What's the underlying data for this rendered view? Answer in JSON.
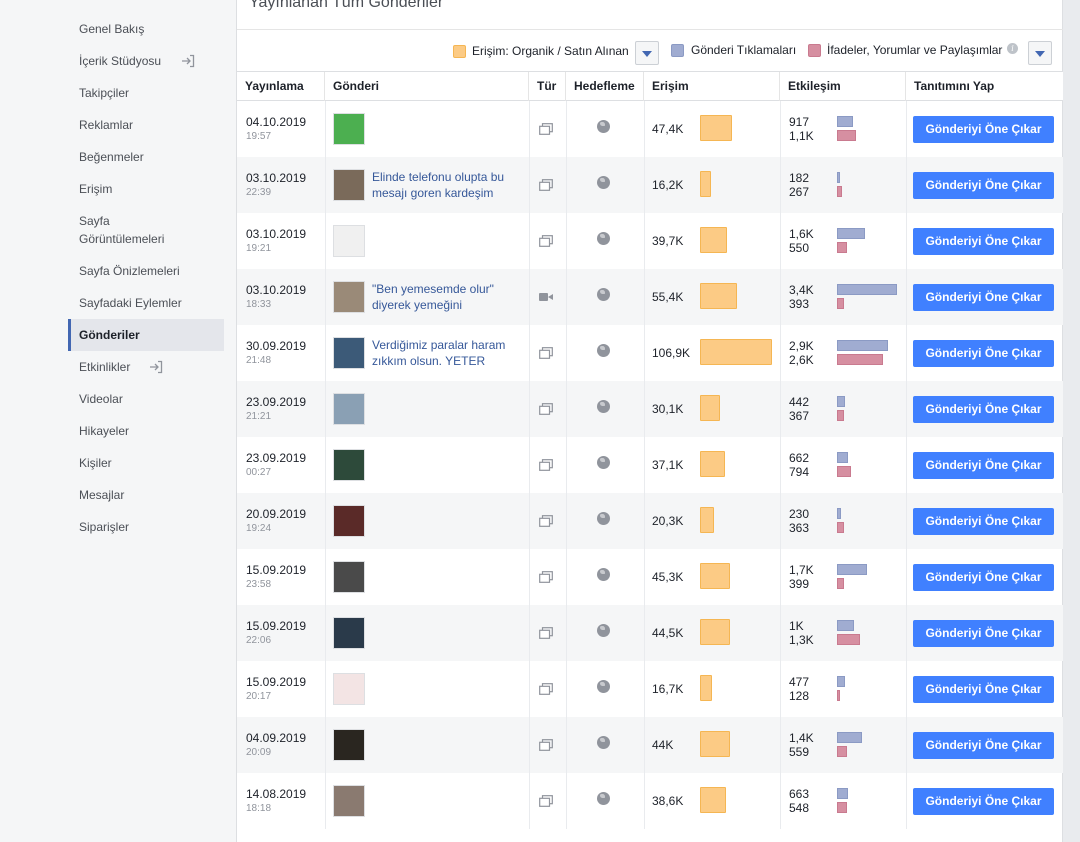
{
  "sidebar": {
    "items": [
      {
        "label": "Genel Bakış"
      },
      {
        "label": "İçerik Stüdyosu",
        "icon": "external-link-icon"
      },
      {
        "label": "Takipçiler"
      },
      {
        "label": "Reklamlar"
      },
      {
        "label": "Beğenmeler"
      },
      {
        "label": "Erişim"
      },
      {
        "label": "Sayfa Görüntülemeleri"
      },
      {
        "label": "Sayfa Önizlemeleri"
      },
      {
        "label": "Sayfadaki Eylemler"
      },
      {
        "label": "Gönderiler",
        "active": true
      },
      {
        "label": "Etkinlikler",
        "icon": "external-link-icon"
      },
      {
        "label": "Videolar"
      },
      {
        "label": "Hikayeler"
      },
      {
        "label": "Kişiler"
      },
      {
        "label": "Mesajlar"
      },
      {
        "label": "Siparişler"
      }
    ]
  },
  "panel": {
    "title": "Yayınlanan Tüm Gönderiler",
    "legend": {
      "reach": "Erişim: Organik / Satın Alınan",
      "clicks": "Gönderi Tıklamaları",
      "reactions": "İfadeler, Yorumlar ve Paylaşımlar"
    },
    "info_glyph": "i"
  },
  "colors": {
    "accent": "#4267b2",
    "button": "#4080ff",
    "reach": "#fccb85",
    "clicks": "#a0acd1",
    "reactions": "#d68fa1"
  },
  "table": {
    "headers": {
      "published": "Yayınlama",
      "post": "Gönderi",
      "type": "Tür",
      "targeting": "Hedefleme",
      "reach": "Erişim",
      "engagement": "Etkileşim",
      "promote": "Tanıtımını Yap"
    },
    "button_label": "Gönderiyi Öne Çıkar",
    "rows": [
      {
        "date": "04.10.2019",
        "time": "19:57",
        "text": "",
        "thumb": "#4caf50",
        "type": "album-icon",
        "reach": "47,4K",
        "reach_frac": 0.44,
        "clicks": "917",
        "clicks_frac": 0.27,
        "reactions": "1,1K",
        "reactions_frac": 0.32
      },
      {
        "date": "03.10.2019",
        "time": "22:39",
        "text": "Elinde telefonu olupta bu mesajı goren kardeşim",
        "thumb": "#7a6a5a",
        "type": "album-icon",
        "reach": "16,2K",
        "reach_frac": 0.15,
        "clicks": "182",
        "clicks_frac": 0.05,
        "reactions": "267",
        "reactions_frac": 0.08
      },
      {
        "date": "03.10.2019",
        "time": "19:21",
        "text": "",
        "thumb": "#f0f0f0",
        "type": "album-icon",
        "reach": "39,7K",
        "reach_frac": 0.37,
        "clicks": "1,6K",
        "clicks_frac": 0.47,
        "reactions": "550",
        "reactions_frac": 0.16
      },
      {
        "date": "03.10.2019",
        "time": "18:33",
        "text": "\"Ben yemesemde olur\" diyerek yemeğini",
        "thumb": "#9a8a78",
        "type": "video-icon",
        "reach": "55,4K",
        "reach_frac": 0.52,
        "clicks": "3,4K",
        "clicks_frac": 1.0,
        "reactions": "393",
        "reactions_frac": 0.12
      },
      {
        "date": "30.09.2019",
        "time": "21:48",
        "text": "Verdiğimiz paralar haram zıkkım olsun. YETER",
        "thumb": "#3c5a78",
        "type": "album-icon",
        "reach": "106,9K",
        "reach_frac": 1.0,
        "clicks": "2,9K",
        "clicks_frac": 0.85,
        "reactions": "2,6K",
        "reactions_frac": 0.77
      },
      {
        "date": "23.09.2019",
        "time": "21:21",
        "text": "",
        "thumb": "#8aa0b4",
        "type": "album-icon",
        "reach": "30,1K",
        "reach_frac": 0.28,
        "clicks": "442",
        "clicks_frac": 0.13,
        "reactions": "367",
        "reactions_frac": 0.11
      },
      {
        "date": "23.09.2019",
        "time": "00:27",
        "text": "",
        "thumb": "#2d4a3a",
        "type": "album-icon",
        "reach": "37,1K",
        "reach_frac": 0.35,
        "clicks": "662",
        "clicks_frac": 0.19,
        "reactions": "794",
        "reactions_frac": 0.23
      },
      {
        "date": "20.09.2019",
        "time": "19:24",
        "text": "",
        "thumb": "#5a2a28",
        "type": "album-icon",
        "reach": "20,3K",
        "reach_frac": 0.19,
        "clicks": "230",
        "clicks_frac": 0.07,
        "reactions": "363",
        "reactions_frac": 0.11
      },
      {
        "date": "15.09.2019",
        "time": "23:58",
        "text": "",
        "thumb": "#4a4a4a",
        "type": "album-icon",
        "reach": "45,3K",
        "reach_frac": 0.42,
        "clicks": "1,7K",
        "clicks_frac": 0.5,
        "reactions": "399",
        "reactions_frac": 0.12
      },
      {
        "date": "15.09.2019",
        "time": "22:06",
        "text": "",
        "thumb": "#2a3a4a",
        "type": "album-icon",
        "reach": "44,5K",
        "reach_frac": 0.42,
        "clicks": "1K",
        "clicks_frac": 0.29,
        "reactions": "1,3K",
        "reactions_frac": 0.38
      },
      {
        "date": "15.09.2019",
        "time": "20:17",
        "text": "",
        "thumb": "#f3e4e4",
        "type": "album-icon",
        "reach": "16,7K",
        "reach_frac": 0.16,
        "clicks": "477",
        "clicks_frac": 0.14,
        "reactions": "128",
        "reactions_frac": 0.04
      },
      {
        "date": "04.09.2019",
        "time": "20:09",
        "text": "",
        "thumb": "#2a2620",
        "type": "album-icon",
        "reach": "44K",
        "reach_frac": 0.41,
        "clicks": "1,4K",
        "clicks_frac": 0.41,
        "reactions": "559",
        "reactions_frac": 0.16
      },
      {
        "date": "14.08.2019",
        "time": "18:18",
        "text": "",
        "thumb": "#8a7a70",
        "type": "album-icon",
        "reach": "38,6K",
        "reach_frac": 0.36,
        "clicks": "663",
        "clicks_frac": 0.19,
        "reactions": "548",
        "reactions_frac": 0.16
      }
    ]
  }
}
